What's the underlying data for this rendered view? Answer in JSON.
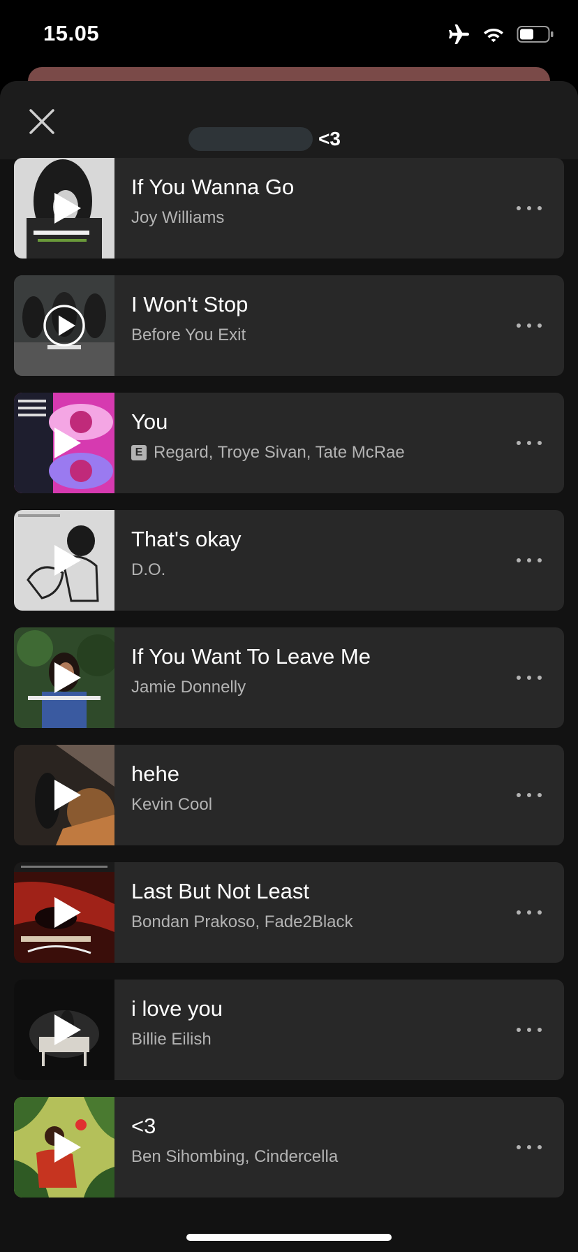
{
  "status_bar": {
    "time": "15.05",
    "icons": [
      "airplane-icon",
      "wifi-icon",
      "battery-icon"
    ]
  },
  "header": {
    "close_icon": "close-icon",
    "title": "<3"
  },
  "tracks": [
    {
      "title": "If You Wanna Go",
      "artist": "Joy Williams",
      "explicit": false,
      "cover": "cover-joy-williams"
    },
    {
      "title": "I Won't Stop",
      "artist": "Before You Exit",
      "explicit": false,
      "cover": "cover-before-you-exit"
    },
    {
      "title": "You",
      "artist": "Regard, Troye Sivan, Tate McRae",
      "explicit": true,
      "explicit_label": "E",
      "cover": "cover-regard"
    },
    {
      "title": "That's okay",
      "artist": "D.O.",
      "explicit": false,
      "cover": "cover-do"
    },
    {
      "title": "If You Want To Leave Me",
      "artist": "Jamie Donnelly",
      "explicit": false,
      "cover": "cover-jamie-donnelly"
    },
    {
      "title": "hehe",
      "artist": "Kevin Cool",
      "explicit": false,
      "cover": "cover-kevin-cool"
    },
    {
      "title": "Last But Not Least",
      "artist": "Bondan Prakoso, Fade2Black",
      "explicit": false,
      "cover": "cover-bondan-prakoso"
    },
    {
      "title": "i love you",
      "artist": "Billie Eilish",
      "explicit": false,
      "cover": "cover-billie-eilish"
    },
    {
      "title": "<3",
      "artist": "Ben Sihombing, Cindercella",
      "explicit": false,
      "cover": "cover-ben-sihombing"
    }
  ],
  "colors": {
    "sheet_background": "#121212",
    "card_background": "#282828",
    "secondary_text": "#b3b3b3",
    "behind_card": "#7a4a48"
  }
}
